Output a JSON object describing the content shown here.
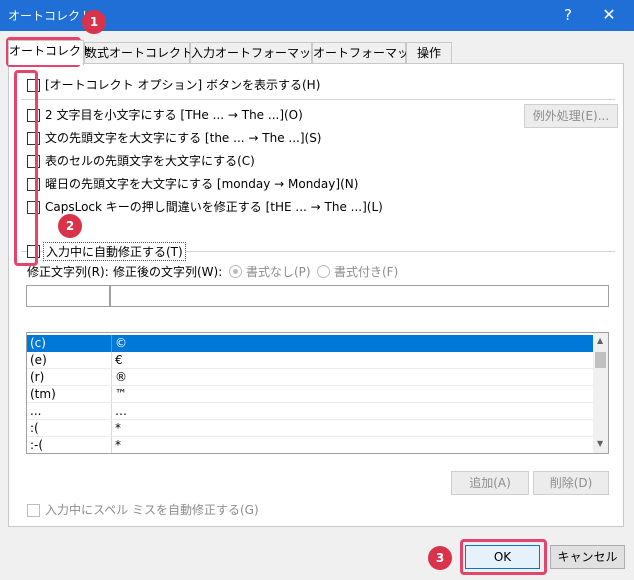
{
  "window": {
    "title": "オートコレクト",
    "help_glyph": "?",
    "close_glyph": "✕"
  },
  "tabs": [
    {
      "label": "オートコレクト",
      "active": true
    },
    {
      "label": "数式オートコレクト",
      "active": false
    },
    {
      "label": "入力オートフォーマット",
      "active": false
    },
    {
      "label": "オートフォーマット",
      "active": false
    },
    {
      "label": "操作",
      "active": false
    }
  ],
  "options": {
    "show_buttons": "[オートコレクト オプション] ボタンを表示する(H)",
    "two_initial_caps": "2 文字目を小文字にする [THe ... → The ...](O)",
    "capitalize_sentence": "文の先頭文字を大文字にする [the ... → The ...](S)",
    "capitalize_table_cell": "表のセルの先頭文字を大文字にする(C)",
    "capitalize_days": "曜日の先頭文字を大文字にする [monday → Monday](N)",
    "caps_lock": "CapsLock キーの押し間違いを修正する [tHE ... → The ...](L)",
    "replace_as_you_type": "入力中に自動修正する(T)"
  },
  "exceptions_button": "例外処理(E)...",
  "replace_label": "修正文字列(R):",
  "with_label": "修正後の文字列(W):",
  "plain_text": "書式なし(P)",
  "formatted_text": "書式付き(F)",
  "entries": [
    {
      "from": "(c)",
      "to": "©",
      "selected": true
    },
    {
      "from": "(e)",
      "to": "€",
      "selected": false
    },
    {
      "from": "(r)",
      "to": "®",
      "selected": false
    },
    {
      "from": "(tm)",
      "to": "™",
      "selected": false
    },
    {
      "from": "...",
      "to": "…",
      "selected": false
    },
    {
      "from": ":(",
      "to": "*",
      "selected": false
    },
    {
      "from": ":-(",
      "to": "*",
      "selected": false
    }
  ],
  "add_button": "追加(A)",
  "delete_button": "削除(D)",
  "spell_check": "入力中にスペル ミスを自動修正する(G)",
  "ok_button": "OK",
  "cancel_button": "キャンセル",
  "annotations": [
    {
      "number": "1"
    },
    {
      "number": "2"
    },
    {
      "number": "3"
    }
  ],
  "colors": {
    "title_bar": "#1f6fd6",
    "selection": "#0078d7",
    "annotation": "#e5456c"
  }
}
